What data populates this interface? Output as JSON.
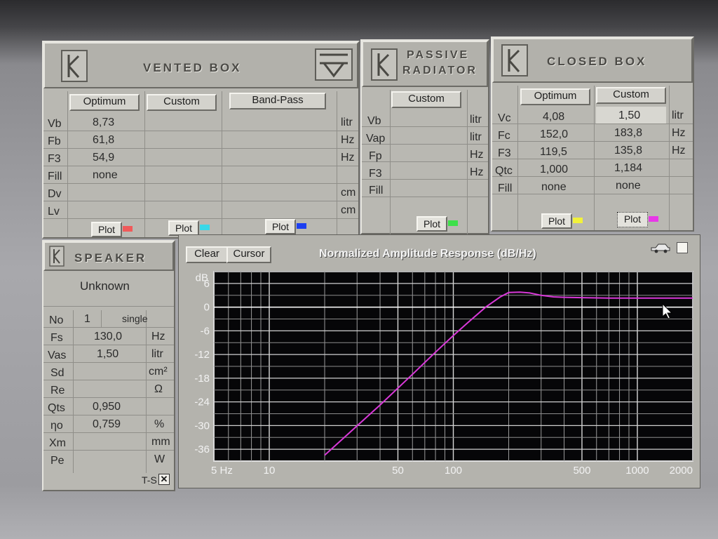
{
  "vented_box": {
    "title": "VENTED BOX",
    "row_labels": [
      "Vb",
      "Fb",
      "F3",
      "Fill",
      "Dv",
      "Lv"
    ],
    "units": [
      "litr",
      "Hz",
      "Hz",
      "",
      "cm",
      "cm"
    ],
    "columns": [
      {
        "header": "Optimum",
        "values": [
          "8,73",
          "61,8",
          "54,9",
          "none",
          "",
          ""
        ],
        "plot": "Plot",
        "color": "#f05a5a"
      },
      {
        "header": "Custom",
        "values": [
          "",
          "",
          "",
          "",
          "",
          ""
        ],
        "plot": "Plot",
        "color": "#3ad8e8"
      },
      {
        "header": "Band-Pass",
        "values": [
          "",
          "",
          "",
          "",
          "",
          ""
        ],
        "plot": "Plot",
        "color": "#1c3ff0"
      }
    ]
  },
  "passive_radiator": {
    "title_line1": "PASSIVE",
    "title_line2": "RADIATOR",
    "row_labels": [
      "Vb",
      "Vap",
      "Fp",
      "F3",
      "Fill"
    ],
    "units": [
      "litr",
      "litr",
      "Hz",
      "Hz",
      ""
    ],
    "column": {
      "header": "Custom",
      "plot": "Plot",
      "color": "#3ee04a"
    }
  },
  "closed_box": {
    "title": "CLOSED BOX",
    "row_labels": [
      "Vc",
      "Fc",
      "F3",
      "Qtc",
      "Fill"
    ],
    "units": [
      "litr",
      "Hz",
      "Hz",
      "",
      ""
    ],
    "columns": [
      {
        "header": "Optimum",
        "values": [
          "4,08",
          "152,0",
          "119,5",
          "1,000",
          "none"
        ],
        "plot": "Plot",
        "color": "#f2f23a"
      },
      {
        "header": "Custom",
        "values": [
          "1,50",
          "183,8",
          "135,8",
          "1,184",
          "none"
        ],
        "plot": "Plot",
        "color": "#e838e8"
      }
    ]
  },
  "speaker": {
    "title": "SPEAKER",
    "name": "Unknown",
    "rows": [
      {
        "label": "No",
        "value": "1",
        "unit": "single"
      },
      {
        "label": "Fs",
        "value": "130,0",
        "unit": "Hz"
      },
      {
        "label": "Vas",
        "value": "1,50",
        "unit": "litr"
      },
      {
        "label": "Sd",
        "value": "",
        "unit": "cm²"
      },
      {
        "label": "Re",
        "value": "",
        "unit": "Ω"
      },
      {
        "label": "Qts",
        "value": "0,950",
        "unit": ""
      },
      {
        "label": "ηo",
        "value": "0,759",
        "unit": "%"
      },
      {
        "label": "Xm",
        "value": "",
        "unit": "mm"
      },
      {
        "label": "Pe",
        "value": "",
        "unit": "W"
      }
    ],
    "ts_label": "T-S",
    "ts_checked": "✕"
  },
  "chart_panel": {
    "clear_label": "Clear",
    "cursor_label": "Cursor"
  },
  "chart_data": {
    "type": "line",
    "title": "Normalized Amplitude Response (dB/Hz)",
    "ylabel": "dB",
    "xscale": "log",
    "xlim": [
      5,
      2000
    ],
    "ylim": [
      -39,
      9
    ],
    "x_tick_labels": [
      "5 Hz",
      "10",
      "50",
      "100",
      "500",
      "1000",
      "2000"
    ],
    "x_tick_values": [
      5,
      10,
      50,
      100,
      500,
      1000,
      2000
    ],
    "y_ticks": [
      6,
      0,
      -6,
      -12,
      -18,
      -24,
      -30,
      -36
    ],
    "grid": true,
    "series": [
      {
        "color": "#d838d8",
        "x": [
          20,
          40,
          60,
          80,
          100,
          120,
          150,
          180,
          200,
          230,
          260,
          300,
          350,
          400,
          500,
          700,
          1000,
          1500,
          2000
        ],
        "y": [
          -37.5,
          -24.8,
          -17.0,
          -11.4,
          -7.2,
          -3.9,
          0.0,
          2.6,
          3.7,
          3.8,
          3.6,
          3.0,
          2.6,
          2.5,
          2.4,
          2.3,
          2.3,
          2.3,
          2.3
        ]
      }
    ]
  }
}
